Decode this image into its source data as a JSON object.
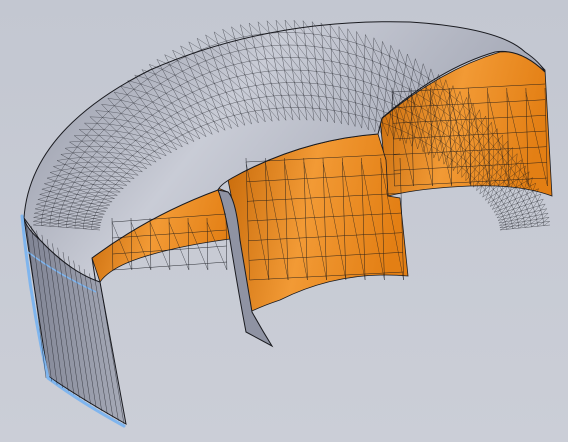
{
  "viewport": {
    "colors": {
      "background_top": "#c3c7d1",
      "background_bottom": "#cbced7",
      "mesh_line": "#111319",
      "outer_surface": "#969aa9",
      "outer_surface_light": "#c9ccd6",
      "inner_surface": "#e37f14",
      "inner_surface_light": "#f29a35",
      "inner_surface_dark": "#c76a0a",
      "selection_edge": "#7fb5ee",
      "cut_edge": "#1a1b20"
    }
  }
}
